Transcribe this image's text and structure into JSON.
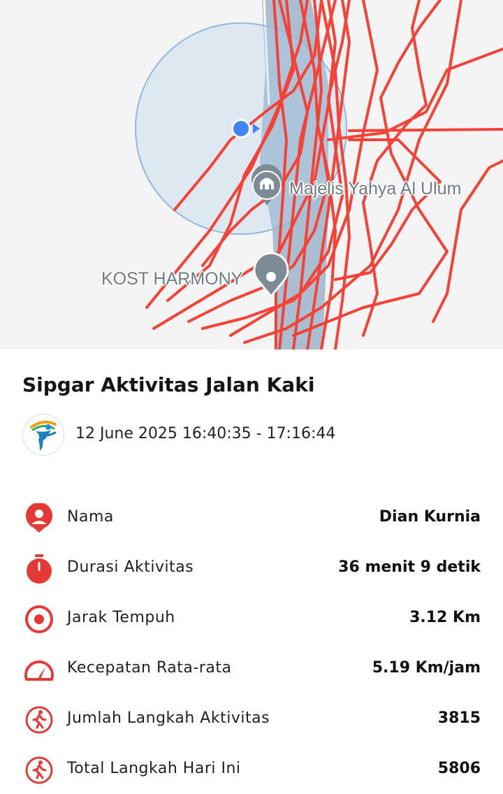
{
  "map": {
    "poi_mosque": "Majelis Yahya Al Ulum",
    "poi_kost": "KOST HARMONY",
    "route_color": "#f44336",
    "location_color": "#4285f4"
  },
  "card": {
    "title": "Sipgar Aktivitas Jalan Kaki",
    "datetime": "12 June 2025 16:40:35 - 17:16:44",
    "rows": [
      {
        "label": "Nama",
        "value": "Dian Kurnia",
        "icon": "person-pin-icon"
      },
      {
        "label": "Durasi Aktivitas",
        "value": "36 menit 9 detik",
        "icon": "stopwatch-icon"
      },
      {
        "label": "Jarak Tempuh",
        "value": "3.12 Km",
        "icon": "target-icon"
      },
      {
        "label": "Kecepatan Rata-rata",
        "value": "5.19 Km/jam",
        "icon": "speedometer-icon"
      },
      {
        "label": "Jumlah Langkah Aktivitas",
        "value": "3815",
        "icon": "walking-icon"
      },
      {
        "label": "Total Langkah Hari Ini",
        "value": "5806",
        "icon": "walking-icon"
      }
    ],
    "accent_color": "#e53935"
  }
}
